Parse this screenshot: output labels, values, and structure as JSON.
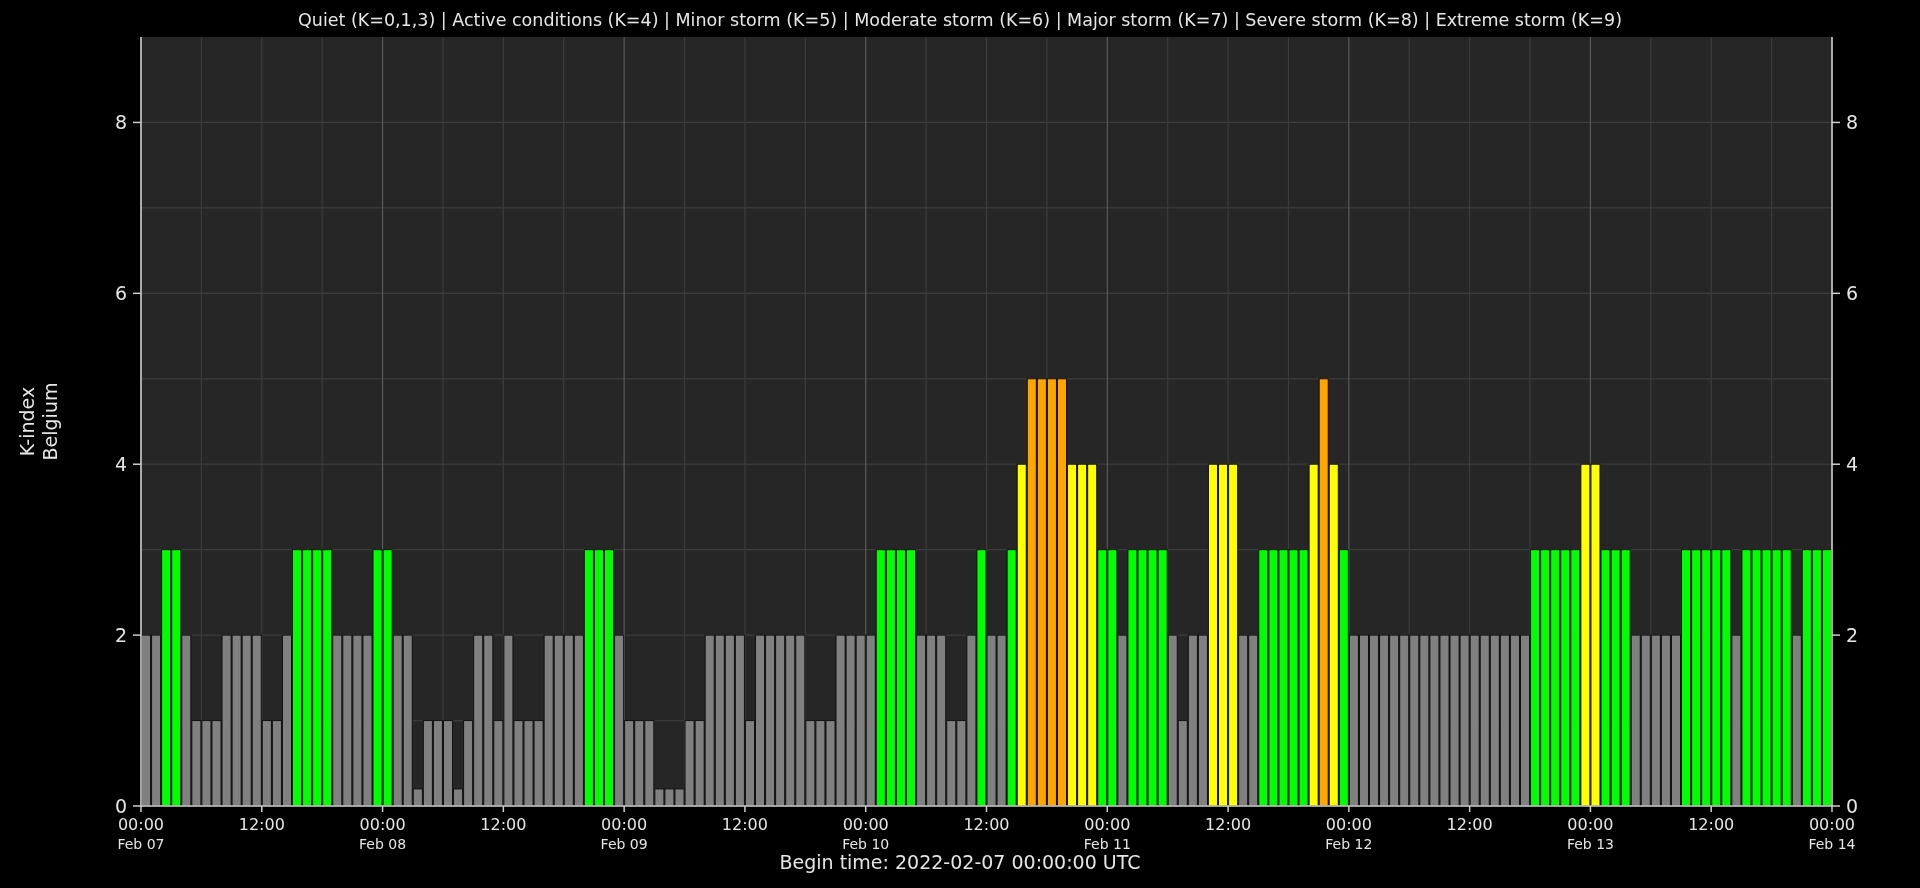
{
  "chart_data": {
    "type": "bar",
    "title": "Quiet (K=0,1,3) | Active conditions (K=4) | Minor storm (K=5) | Moderate storm (K=6) | Major storm (K=7) | Severe storm (K=8) | Extreme storm (K=9)",
    "xlabel": "Begin time: 2022-02-07 00:00:00 UTC",
    "ylabel": "K-index\nBelgium",
    "grid": true,
    "ylim": [
      0,
      9
    ],
    "yticks": [
      0,
      2,
      4,
      6,
      8
    ],
    "y2lim": [
      0,
      9
    ],
    "y2ticks": [
      0,
      2,
      4,
      6,
      8
    ],
    "series": [
      {
        "values": [
          2,
          2,
          3,
          3,
          2,
          1,
          1,
          1,
          2,
          2,
          2,
          2,
          1,
          1,
          2,
          3,
          3,
          3,
          3,
          2,
          2,
          2,
          2,
          3,
          3,
          2,
          2,
          0.2,
          1,
          1,
          1,
          0.2,
          1,
          2,
          2,
          1,
          2,
          1,
          1,
          1,
          2,
          2,
          2,
          2,
          3,
          3,
          3,
          2,
          1,
          1,
          1,
          0.2,
          0.2,
          0.2,
          1,
          1,
          2,
          2,
          2,
          2,
          1,
          2,
          2,
          2,
          2,
          2,
          1,
          1,
          1,
          2,
          2,
          2,
          2,
          3,
          3,
          3,
          3,
          2,
          2,
          2,
          1,
          1,
          2,
          3,
          2,
          2,
          3,
          4,
          5,
          5,
          5,
          5,
          4,
          4,
          4,
          3,
          3,
          2,
          3,
          3,
          3,
          3,
          2,
          1,
          2,
          2,
          4,
          4,
          4,
          2,
          2,
          3,
          3,
          3,
          3,
          3,
          4,
          5,
          4,
          3,
          2,
          2,
          2,
          2,
          2,
          2,
          2,
          2,
          2,
          2,
          2,
          2,
          2,
          2,
          2,
          2,
          2,
          2,
          3,
          3,
          3,
          3,
          3,
          4,
          4,
          3,
          3,
          3,
          2,
          2,
          2,
          2,
          2,
          3,
          3,
          3,
          3,
          3,
          2,
          3,
          3,
          3,
          3,
          3,
          2,
          3,
          3,
          3
        ]
      }
    ]
  },
  "x_axis": {
    "time_labels": [
      "00:00",
      "12:00",
      "00:00",
      "12:00",
      "00:00",
      "12:00",
      "00:00",
      "12:00",
      "00:00",
      "12:00",
      "00:00",
      "12:00",
      "00:00",
      "12:00",
      "00:00"
    ],
    "date_labels": [
      "Feb 07",
      "Feb 08",
      "Feb 09",
      "Feb 10",
      "Feb 11",
      "Feb 12",
      "Feb 13",
      "Feb 14"
    ]
  }
}
